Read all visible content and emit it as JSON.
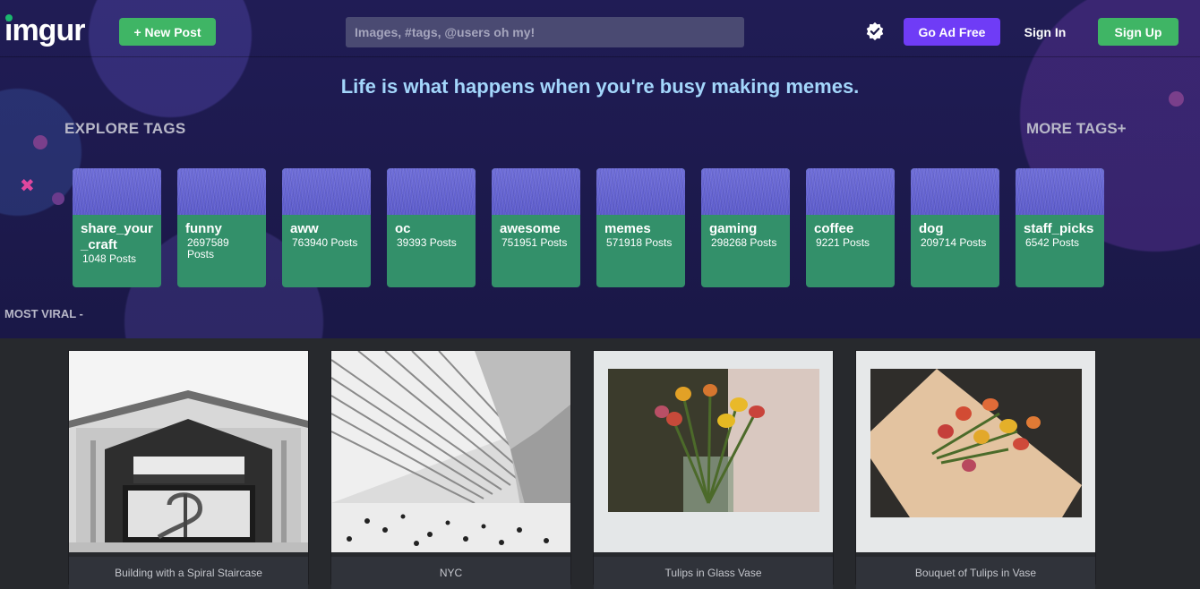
{
  "header": {
    "logo": "imgur",
    "new_post_label": "+ New Post",
    "search_placeholder": "Images, #tags, @users oh my!",
    "verified_icon": "verified-badge-icon",
    "go_ad_free_label": "Go Ad Free",
    "sign_in_label": "Sign In",
    "sign_up_label": "Sign Up"
  },
  "hero": {
    "tagline": "Life is what happens when you're busy making memes.",
    "explore_tags_label": "EXPLORE TAGS",
    "more_tags_label": "MORE TAGS+",
    "most_viral_label": "MOST VIRAL -"
  },
  "tags": [
    {
      "name": "share_your_craft",
      "count": "1048 Posts"
    },
    {
      "name": "funny",
      "count": "2697589 Posts"
    },
    {
      "name": "aww",
      "count": "763940 Posts"
    },
    {
      "name": "oc",
      "count": "39393 Posts"
    },
    {
      "name": "awesome",
      "count": "751951 Posts"
    },
    {
      "name": "memes",
      "count": "571918 Posts"
    },
    {
      "name": "gaming",
      "count": "298268 Posts"
    },
    {
      "name": "coffee",
      "count": "9221 Posts"
    },
    {
      "name": "dog",
      "count": "209714 Posts"
    },
    {
      "name": "staff_picks",
      "count": "6542 Posts"
    }
  ],
  "posts": [
    {
      "title": "Building with a Spiral Staircase"
    },
    {
      "title": "NYC"
    },
    {
      "title": "Tulips in Glass Vase"
    },
    {
      "title": "Bouquet of Tulips in Vase"
    }
  ],
  "colors": {
    "accent_green": "#3fb565",
    "accent_purple": "#6f3cf6",
    "tag_green": "#33906a",
    "tagline_blue": "#a3d6fb",
    "hero_bg": "#1b1a4a",
    "page_bg": "#27292d"
  }
}
